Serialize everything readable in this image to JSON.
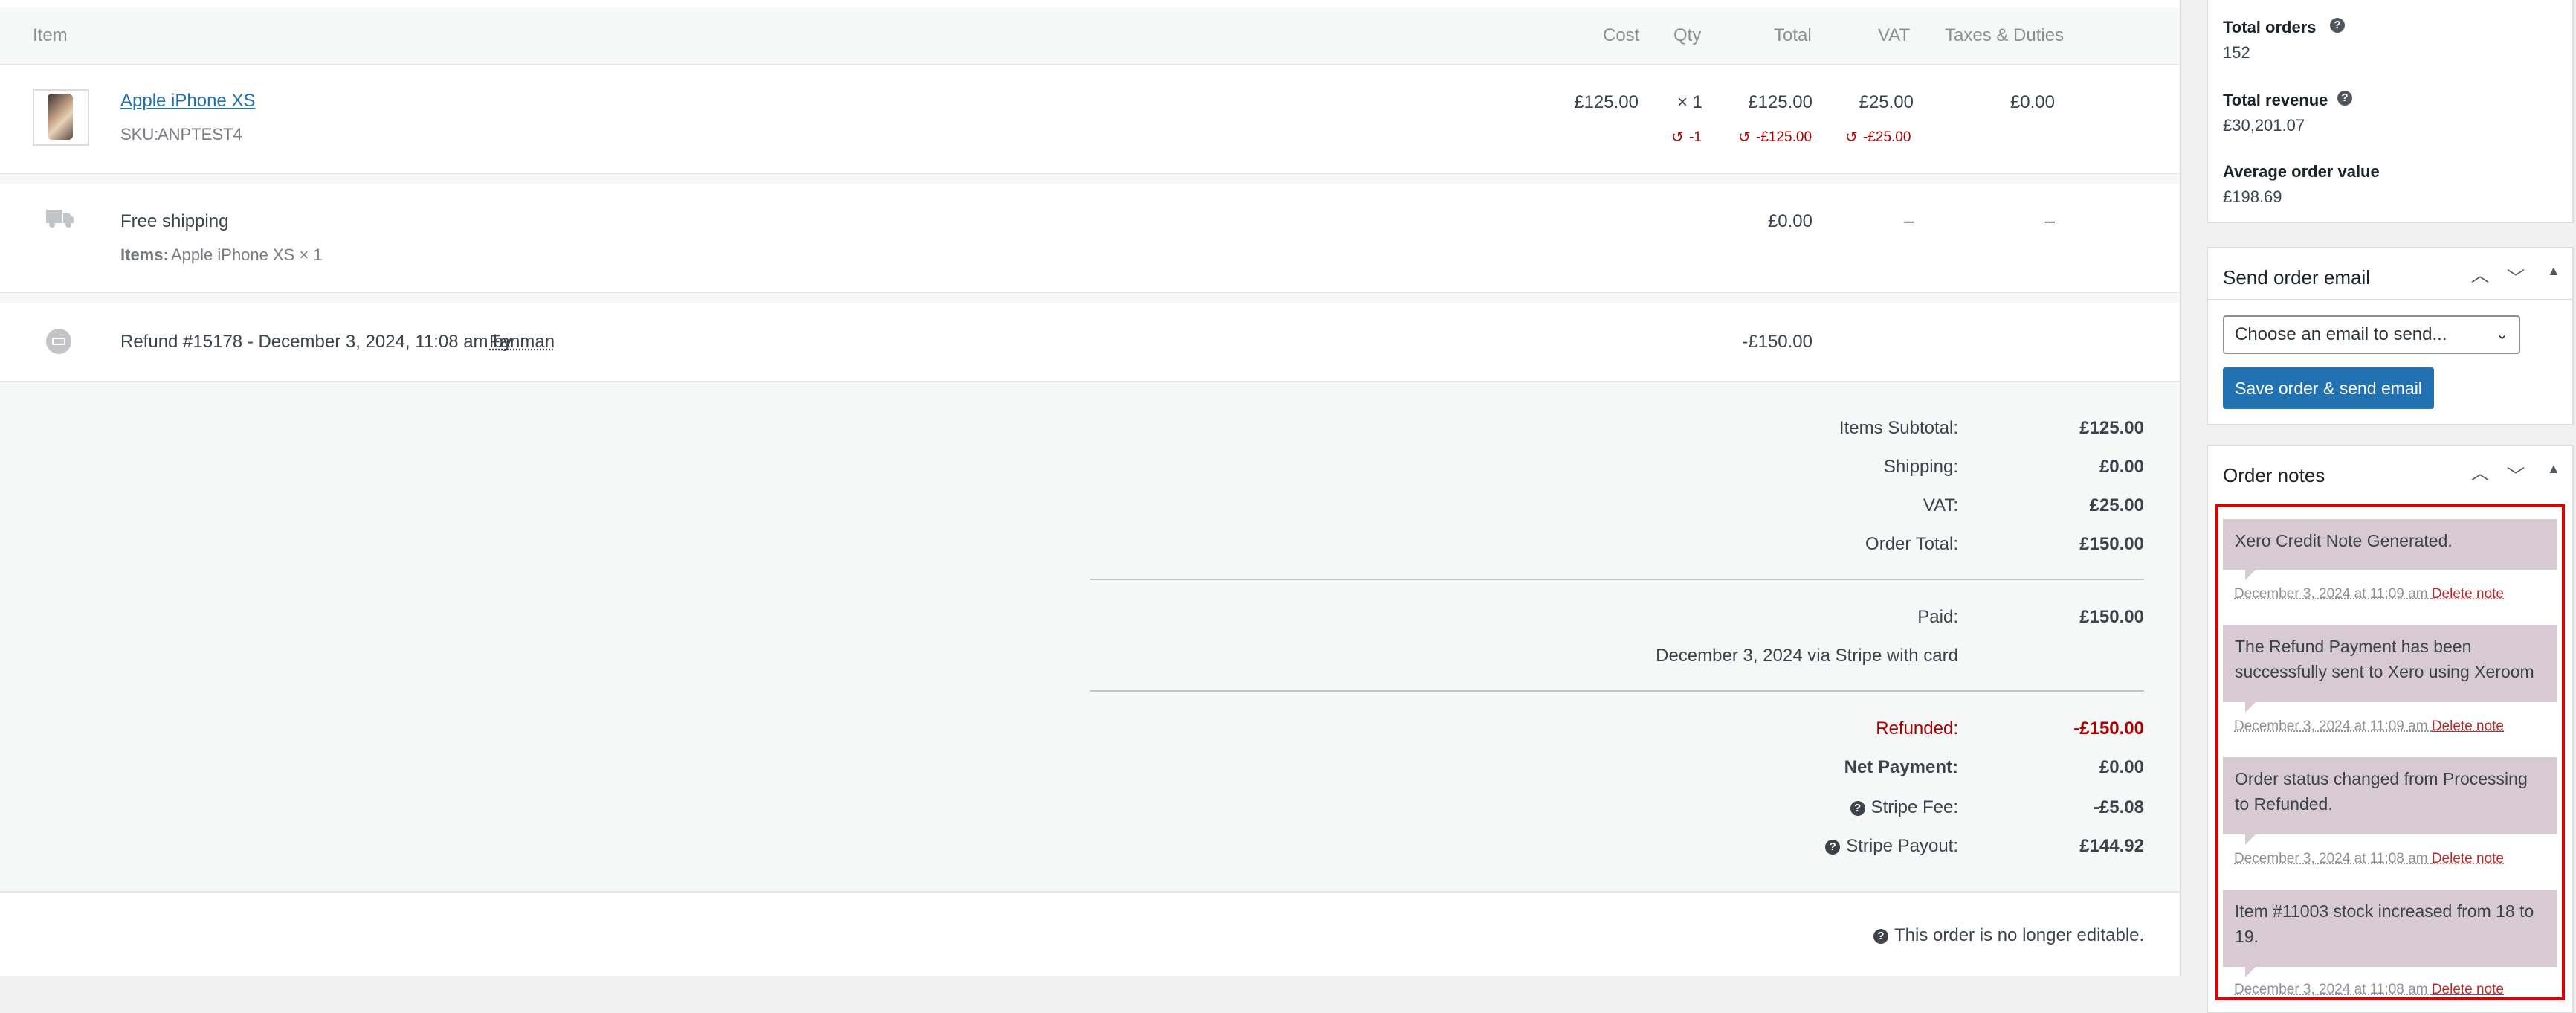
{
  "items_table": {
    "headers": {
      "item": "Item",
      "cost": "Cost",
      "qty": "Qty",
      "total": "Total",
      "vat": "VAT",
      "taxes": "Taxes & Duties"
    },
    "product": {
      "name": "Apple iPhone XS",
      "sku_label": "SKU:",
      "sku": "ANPTEST4",
      "cost": "£125.00",
      "qty": "× 1",
      "total": "£125.00",
      "vat": "£25.00",
      "taxes": "£0.00",
      "refund_qty": "-1",
      "refund_total": "-£125.00",
      "refund_vat": "-£25.00"
    },
    "shipping": {
      "name": "Free shipping",
      "items_label": "Items:",
      "items_value": "Apple iPhone XS × 1",
      "total": "£0.00",
      "vat": "–",
      "taxes": "–"
    },
    "refund": {
      "text": "Refund #15178 - December 3, 2024, 11:08 am by",
      "user": "Fanman",
      "amount": "-£150.00"
    }
  },
  "totals": {
    "items_subtotal_label": "Items Subtotal:",
    "items_subtotal": "£125.00",
    "shipping_label": "Shipping:",
    "shipping": "£0.00",
    "vat_label": "VAT:",
    "vat": "£25.00",
    "order_total_label": "Order Total:",
    "order_total": "£150.00",
    "paid_label": "Paid:",
    "paid": "£150.00",
    "paid_note": "December 3, 2024 via Stripe with card",
    "refunded_label": "Refunded:",
    "refunded": "-£150.00",
    "net_label": "Net Payment:",
    "net": "£0.00",
    "stripe_fee_label": "Stripe Fee:",
    "stripe_fee": "-£5.08",
    "stripe_payout_label": "Stripe Payout:",
    "stripe_payout": "£144.92",
    "not_editable": "This order is no longer editable."
  },
  "customer_stats": {
    "total_orders_label": "Total orders",
    "total_orders": "152",
    "total_revenue_label": "Total revenue",
    "total_revenue": "£30,201.07",
    "aov_label": "Average order value",
    "aov": "£198.69"
  },
  "send_email": {
    "title": "Send order email",
    "select_value": "Choose an email to send...",
    "button": "Save order & send email"
  },
  "order_notes": {
    "title": "Order notes",
    "delete_label": "Delete note",
    "notes": [
      {
        "text": "Xero Credit Note Generated.",
        "date": "December 3, 2024 at 11:09 am"
      },
      {
        "text": "The Refund Payment has been successfully sent to Xero using Xeroom",
        "date": "December 3, 2024 at 11:09 am"
      },
      {
        "text": "Order status changed from Processing to Refunded.",
        "date": "December 3, 2024 at 11:08 am"
      },
      {
        "text": "Item #11003 stock increased from 18 to 19.",
        "date": "December 3, 2024 at 11:08 am"
      }
    ]
  },
  "colors": {
    "accent": "#2271b1",
    "refund_red": "#aa0000",
    "note_bg": "#d7cad2",
    "highlight": "#e00000"
  }
}
